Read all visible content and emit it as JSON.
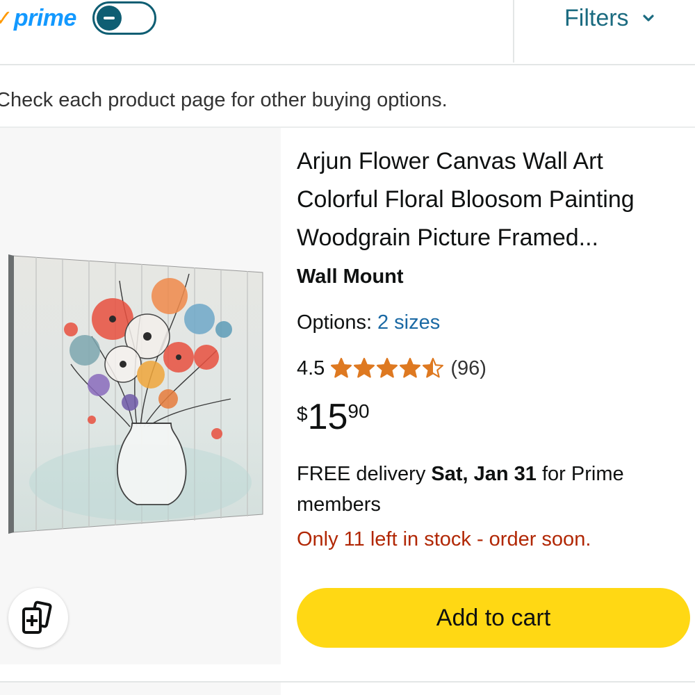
{
  "header": {
    "prime_logo_text": "prime",
    "prime_toggle_state": "off",
    "filters_label": "Filters"
  },
  "notice_text": "Check each product page for other buying options.",
  "product": {
    "title_lines": [
      "Arjun Flower Canvas Wall Art",
      "Colorful Floral Bloosom Painting",
      "Woodgrain Picture Framed..."
    ],
    "brand": "Wall Mount",
    "options_label": "Options:",
    "options_value": "2 sizes",
    "rating": "4.5",
    "rating_value": 4.5,
    "review_count": "(96)",
    "price_symbol": "$",
    "price_whole": "15",
    "price_fraction": "90",
    "delivery_prefix": "FREE delivery",
    "delivery_date": "Sat, Jan 31",
    "delivery_suffix": "for Prime",
    "delivery_line2": "members",
    "stock_text": "Only 11 left in stock - order soon.",
    "add_to_cart_label": "Add to cart"
  },
  "icons": {
    "prime_check": "check-icon",
    "filters_chevron": "chevron-down-icon",
    "compare": "compare-icon",
    "star": "star-icon"
  },
  "colors": {
    "prime_blue": "#1399ff",
    "prime_orange": "#ff9900",
    "toggle_teal": "#0f5e73",
    "filters_teal": "#1b6b80",
    "link_blue": "#1a69a4",
    "star_orange": "#de7921",
    "stock_red": "#b12704",
    "cart_yellow": "#ffd814"
  }
}
